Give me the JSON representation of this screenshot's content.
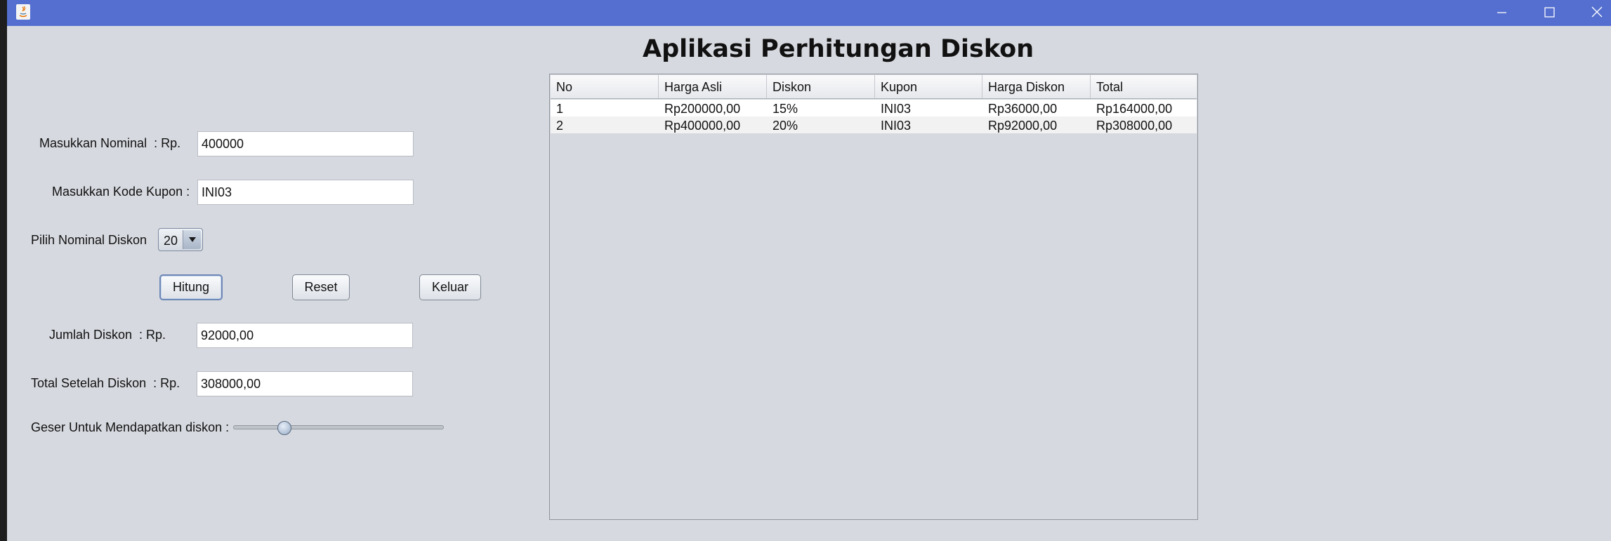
{
  "window": {
    "title": ""
  },
  "app_title": "Aplikasi Perhitungan Diskon",
  "form": {
    "nominal_label": "Masukkan Nominal  : Rp.",
    "nominal_value": "400000",
    "kupon_label": "Masukkan Kode Kupon :",
    "kupon_value": "INI03",
    "diskon_label": "Pilih Nominal Diskon",
    "diskon_selected": "20",
    "jumlah_label": "Jumlah Diskon  : Rp.",
    "jumlah_value": "92000,00",
    "total_label": "Total Setelah Diskon  : Rp.",
    "total_value": "308000,00",
    "slider_label": "Geser Untuk Mendapatkan diskon :"
  },
  "buttons": {
    "hitung": "Hitung",
    "reset": "Reset",
    "keluar": "Keluar"
  },
  "table": {
    "columns": [
      "No",
      "Harga Asli",
      "Diskon",
      "Kupon",
      "Harga Diskon",
      "Total"
    ],
    "rows": [
      [
        "1",
        "Rp200000,00",
        "15%",
        "INI03",
        "Rp36000,00",
        "Rp164000,00"
      ],
      [
        "2",
        "Rp400000,00",
        "20%",
        "INI03",
        "Rp92000,00",
        "Rp308000,00"
      ]
    ]
  },
  "colors": {
    "titlebar": "#546fcf",
    "window_bg": "#d6d9df"
  },
  "icons": [
    "java-app-icon",
    "minimize-icon",
    "maximize-icon",
    "close-icon",
    "chevron-down-icon"
  ]
}
